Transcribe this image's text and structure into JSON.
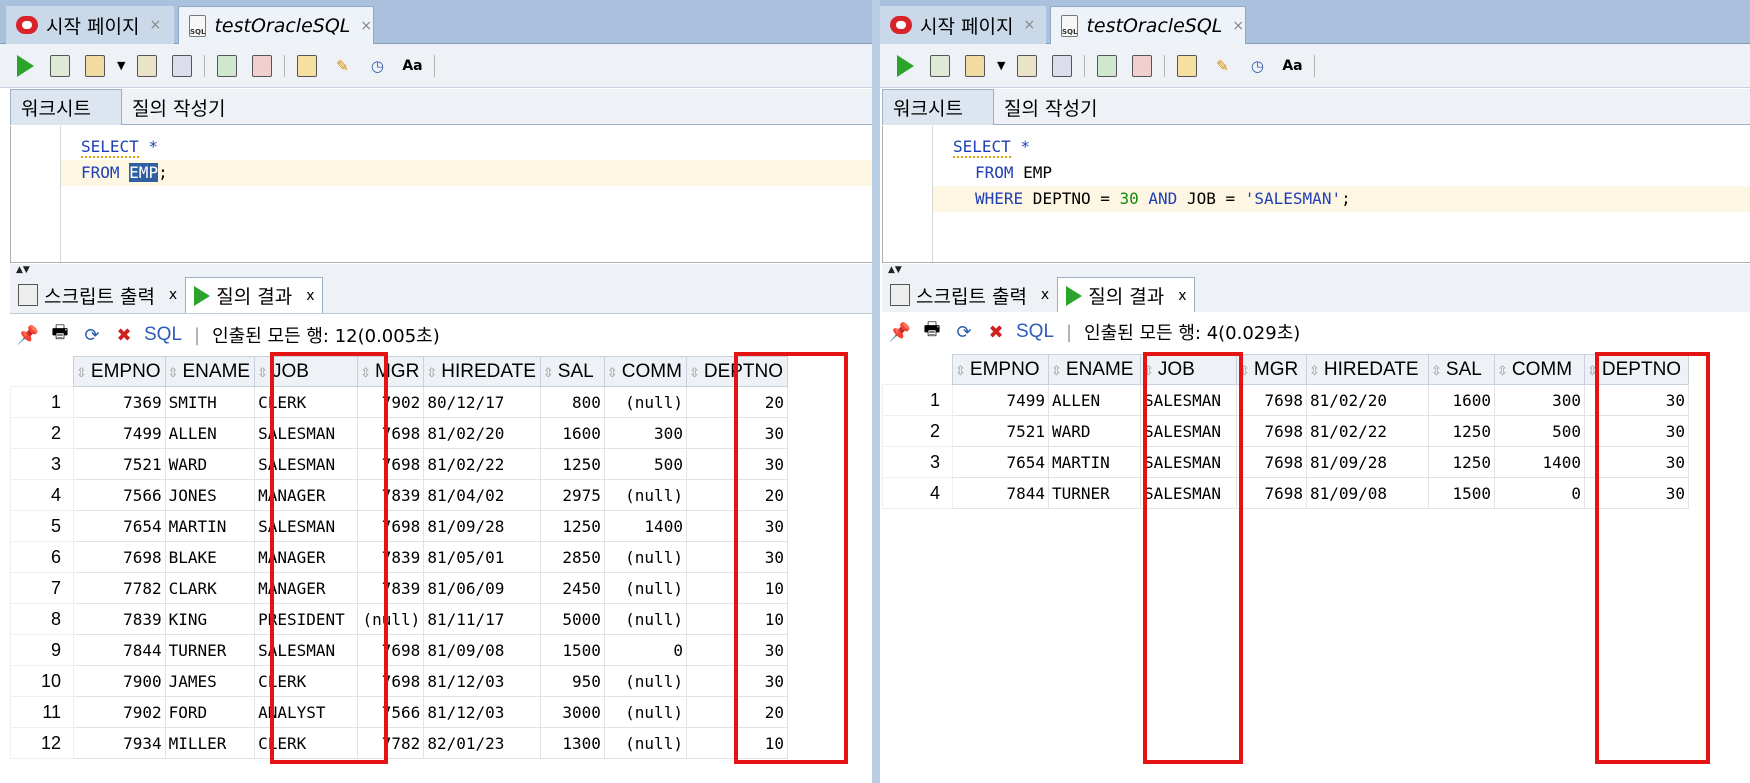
{
  "left": {
    "tabs": [
      {
        "label": "시작 페이지",
        "close": "×",
        "icon": "oracle-icon"
      },
      {
        "label": "testOracleSQL",
        "close": "×",
        "icon": "sql-file-icon"
      }
    ],
    "worksheet_tabs": [
      "워크시트",
      "질의 작성기"
    ],
    "editor": {
      "line1": {
        "kw": "SELECT",
        "rest": " *"
      },
      "line2": {
        "kw": "FROM",
        "table": "EMP",
        "end": ";"
      }
    },
    "result_tabs": [
      {
        "label": "스크립트 출력",
        "close": "x"
      },
      {
        "label": "질의 결과",
        "close": "x"
      }
    ],
    "result_toolbar": {
      "sql": "SQL",
      "sep": "|",
      "status": "인출된 모든 행: 12(0.005초)"
    },
    "columns": [
      "EMPNO",
      "ENAME",
      "JOB",
      "MGR",
      "HIREDATE",
      "SAL",
      "COMM",
      "DEPTNO"
    ],
    "rows": [
      [
        "1",
        "7369",
        "SMITH",
        "CLERK",
        "7902",
        "80/12/17",
        "800",
        "(null)",
        "20"
      ],
      [
        "2",
        "7499",
        "ALLEN",
        "SALESMAN",
        "7698",
        "81/02/20",
        "1600",
        "300",
        "30"
      ],
      [
        "3",
        "7521",
        "WARD",
        "SALESMAN",
        "7698",
        "81/02/22",
        "1250",
        "500",
        "30"
      ],
      [
        "4",
        "7566",
        "JONES",
        "MANAGER",
        "7839",
        "81/04/02",
        "2975",
        "(null)",
        "20"
      ],
      [
        "5",
        "7654",
        "MARTIN",
        "SALESMAN",
        "7698",
        "81/09/28",
        "1250",
        "1400",
        "30"
      ],
      [
        "6",
        "7698",
        "BLAKE",
        "MANAGER",
        "7839",
        "81/05/01",
        "2850",
        "(null)",
        "30"
      ],
      [
        "7",
        "7782",
        "CLARK",
        "MANAGER",
        "7839",
        "81/06/09",
        "2450",
        "(null)",
        "10"
      ],
      [
        "8",
        "7839",
        "KING",
        "PRESIDENT",
        "(null)",
        "81/11/17",
        "5000",
        "(null)",
        "10"
      ],
      [
        "9",
        "7844",
        "TURNER",
        "SALESMAN",
        "7698",
        "81/09/08",
        "1500",
        "0",
        "30"
      ],
      [
        "10",
        "7900",
        "JAMES",
        "CLERK",
        "7698",
        "81/12/03",
        "950",
        "(null)",
        "30"
      ],
      [
        "11",
        "7902",
        "FORD",
        "ANALYST",
        "7566",
        "81/12/03",
        "3000",
        "(null)",
        "20"
      ],
      [
        "12",
        "7934",
        "MILLER",
        "CLERK",
        "7782",
        "82/01/23",
        "1300",
        "(null)",
        "10"
      ]
    ]
  },
  "right": {
    "tabs": [
      {
        "label": "시작 페이지",
        "close": "×",
        "icon": "oracle-icon"
      },
      {
        "label": "testOracleSQL",
        "close": "×",
        "icon": "sql-file-icon"
      }
    ],
    "worksheet_tabs": [
      "워크시트",
      "질의 작성기"
    ],
    "editor": {
      "line1": {
        "kw": "SELECT",
        "rest": " *"
      },
      "line2": {
        "kw": "FROM",
        "rest": " EMP"
      },
      "line3": {
        "kw1": "WHERE",
        "a": " DEPTNO = ",
        "n": "30",
        "kw2": "AND",
        "b": " JOB = ",
        "s": "'SALESMAN'",
        "end": ";"
      }
    },
    "result_tabs": [
      {
        "label": "스크립트 출력",
        "close": "x"
      },
      {
        "label": "질의 결과",
        "close": "x"
      }
    ],
    "result_toolbar": {
      "sql": "SQL",
      "sep": "|",
      "status": "인출된 모든 행: 4(0.029초)"
    },
    "columns": [
      "EMPNO",
      "ENAME",
      "JOB",
      "MGR",
      "HIREDATE",
      "SAL",
      "COMM",
      "DEPTNO"
    ],
    "rows": [
      [
        "1",
        "7499",
        "ALLEN",
        "SALESMAN",
        "7698",
        "81/02/20",
        "1600",
        "300",
        "30"
      ],
      [
        "2",
        "7521",
        "WARD",
        "SALESMAN",
        "7698",
        "81/02/22",
        "1250",
        "500",
        "30"
      ],
      [
        "3",
        "7654",
        "MARTIN",
        "SALESMAN",
        "7698",
        "81/09/28",
        "1250",
        "1400",
        "30"
      ],
      [
        "4",
        "7844",
        "TURNER",
        "SALESMAN",
        "7698",
        "81/09/08",
        "1500",
        "0",
        "30"
      ]
    ]
  },
  "highlight_color": "#e41414",
  "toolbar_icons": [
    "run-statement-icon",
    "run-script-icon",
    "commit-icon",
    "rollback-icon",
    "explain-plan-icon",
    "autotrace-icon",
    "format-sql-icon",
    "clear-icon",
    "history-icon",
    "case-toggle-icon"
  ]
}
